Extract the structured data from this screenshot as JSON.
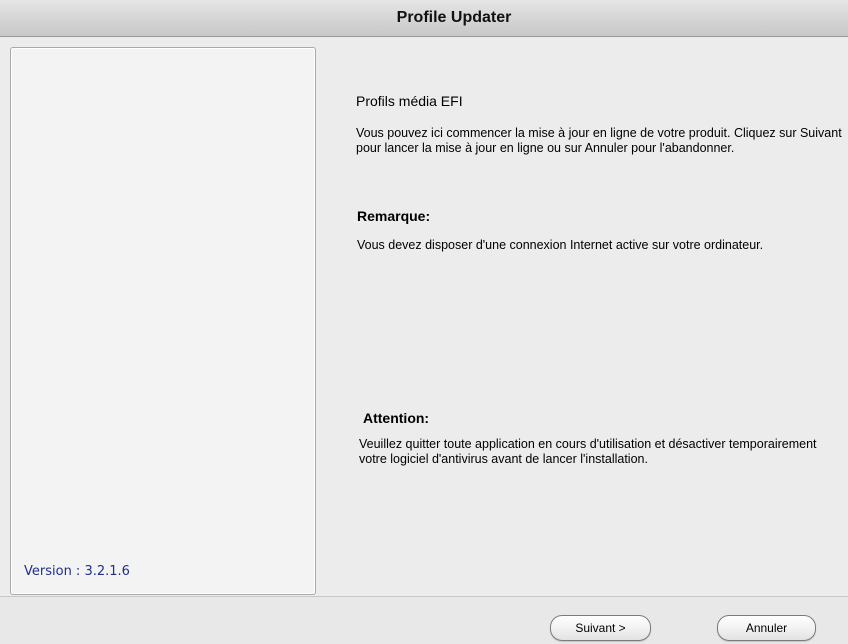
{
  "window": {
    "title": "Profile Updater"
  },
  "sidebar": {
    "version_text": "Version : 3.2.1.6"
  },
  "main": {
    "heading": "Profils média EFI",
    "intro": "Vous pouvez ici commencer la mise à jour en ligne de votre produit. Cliquez sur Suivant pour lancer la mise à jour en ligne ou sur Annuler pour l'abandonner.",
    "remarque_title": "Remarque:",
    "remarque_text": "Vous devez disposer d'une connexion Internet active sur votre ordinateur.",
    "attention_title": "Attention:",
    "attention_text": "Veuillez quitter toute application en cours d'utilisation et désactiver temporairement votre logiciel d'antivirus avant de lancer l'installation."
  },
  "buttons": {
    "next_label": "Suivant >",
    "cancel_label": "Annuler"
  }
}
